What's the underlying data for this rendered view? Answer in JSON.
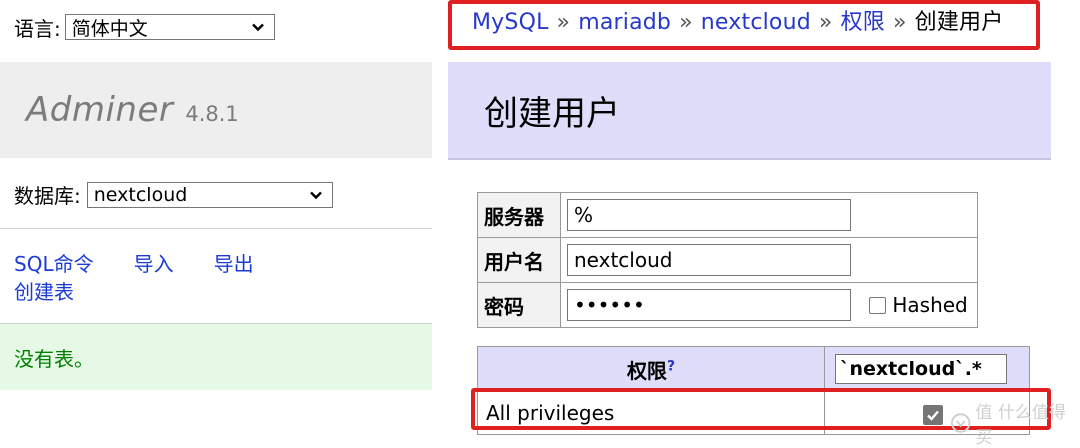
{
  "language": {
    "label": "语言:",
    "selected": "简体中文"
  },
  "brand": {
    "name": "Adminer",
    "version": "4.8.1"
  },
  "database": {
    "label": "数据库:",
    "selected": "nextcloud"
  },
  "links": {
    "sql_command": "SQL命令",
    "import": "导入",
    "export": "导出",
    "create_table": "创建表"
  },
  "no_tables": "没有表。",
  "breadcrumb": {
    "items": [
      "MySQL",
      "mariadb",
      "nextcloud",
      "权限"
    ],
    "separator": "»",
    "current": "创建用户"
  },
  "page_title": "创建用户",
  "user_form": {
    "server_label": "服务器",
    "server_value": "%",
    "username_label": "用户名",
    "username_value": "nextcloud",
    "password_label": "密码",
    "password_value": "••••••",
    "hashed_label": "Hashed"
  },
  "privileges": {
    "header": "权限",
    "help_mark": "?",
    "scope_value": "`nextcloud`.*",
    "all_privileges_label": "All privileges",
    "all_privileges_checked": true
  },
  "watermark": "值 什么值得买",
  "colors": {
    "highlight": "#e02020",
    "link": "#2638c9",
    "header_band": "#dedefa",
    "success_bg": "#e6f9e6"
  }
}
